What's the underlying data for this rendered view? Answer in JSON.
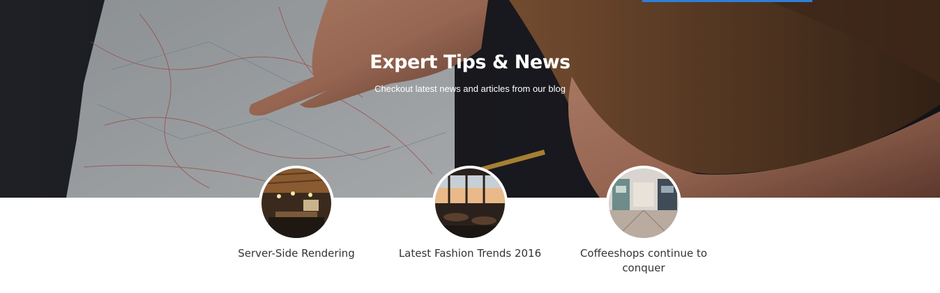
{
  "hero": {
    "title": "Expert Tips & News",
    "subtitle": "Checkout latest news and articles from our blog",
    "background_image": "hand-pointing-at-map-photo"
  },
  "posts": [
    {
      "title": "Server-Side Rendering",
      "image": "restaurant-interior-photo"
    },
    {
      "title": "Latest Fashion Trends 2016",
      "image": "restaurant-sunset-view-photo"
    },
    {
      "title": "Coffeeshops continue to conquer",
      "image": "shopping-mall-photo"
    }
  ],
  "colors": {
    "accent_strip": "#2f7fd6",
    "post_title": "#333333",
    "hero_text": "#ffffff"
  }
}
